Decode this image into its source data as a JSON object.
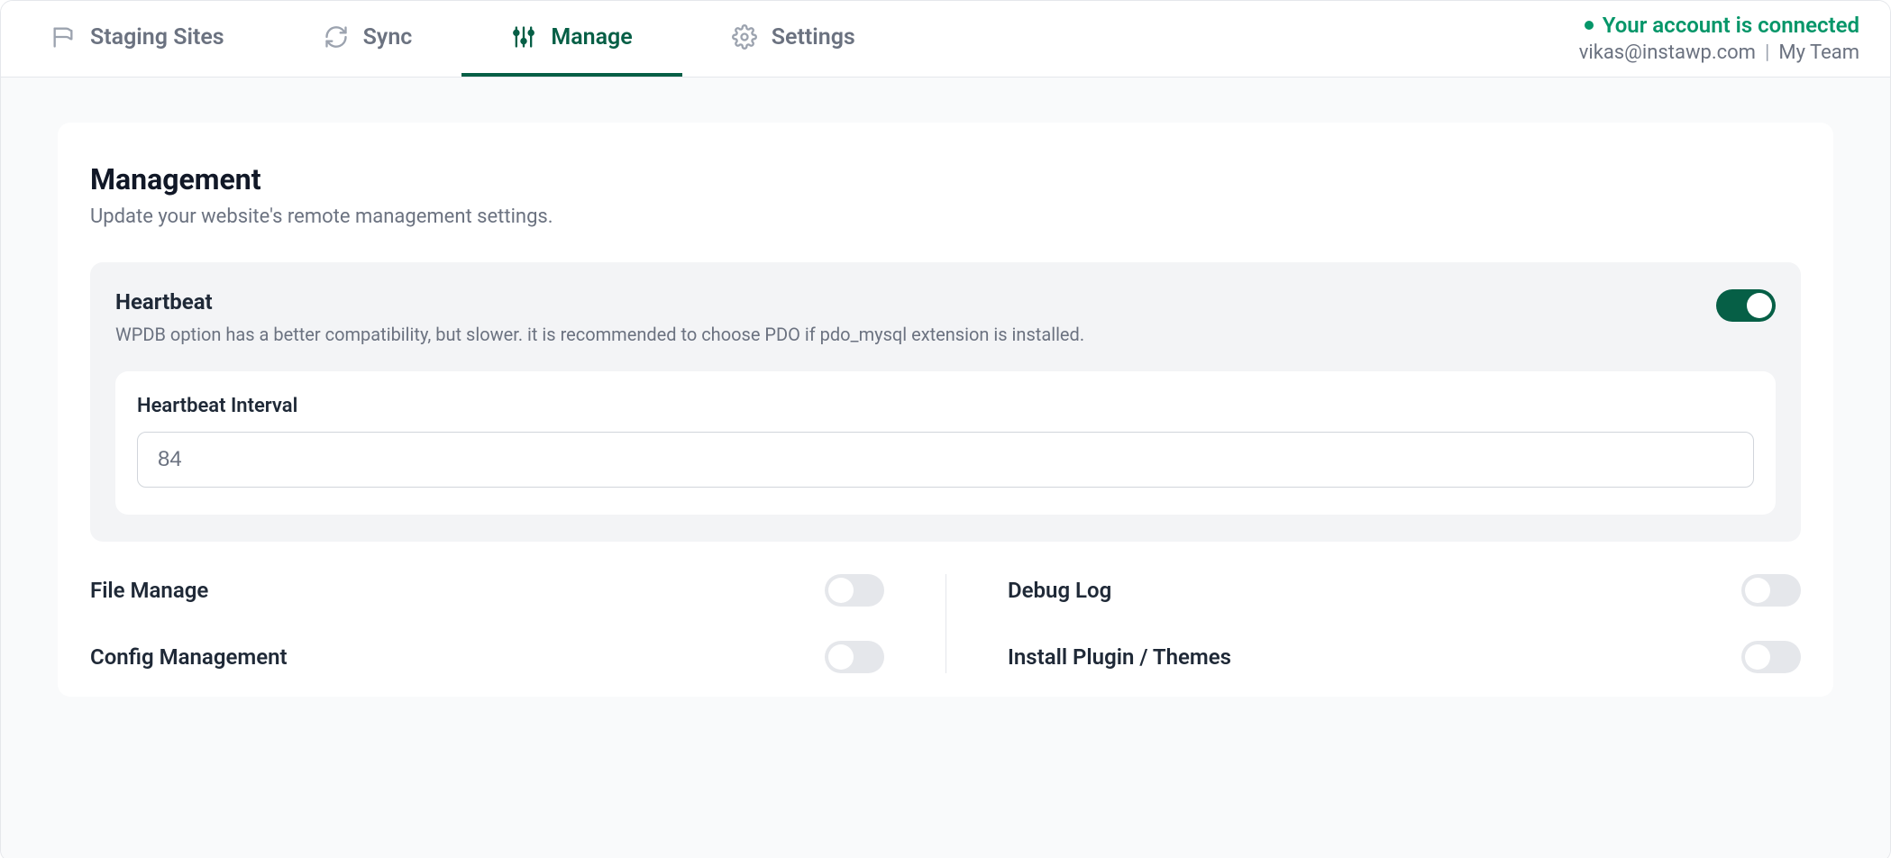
{
  "nav": {
    "tabs": [
      {
        "id": "staging",
        "label": "Staging Sites",
        "icon": "flag",
        "active": false
      },
      {
        "id": "sync",
        "label": "Sync",
        "icon": "refresh",
        "active": false
      },
      {
        "id": "manage",
        "label": "Manage",
        "icon": "sliders",
        "active": true
      },
      {
        "id": "settings",
        "label": "Settings",
        "icon": "gear",
        "active": false
      }
    ]
  },
  "account": {
    "status_text": "Your account is connected",
    "email": "vikas@instawp.com",
    "team": "My Team"
  },
  "page": {
    "title": "Management",
    "subtitle": "Update your website's remote management settings."
  },
  "heartbeat": {
    "title": "Heartbeat",
    "description": "WPDB option has a better compatibility, but slower. it is recommended to choose PDO if pdo_mysql extension is installed.",
    "enabled": true,
    "interval_label": "Heartbeat Interval",
    "interval_value": "84"
  },
  "options": {
    "left": [
      {
        "id": "file_manage",
        "label": "File Manage",
        "enabled": false
      },
      {
        "id": "config_management",
        "label": "Config Management",
        "enabled": false
      }
    ],
    "right": [
      {
        "id": "debug_log",
        "label": "Debug Log",
        "enabled": false
      },
      {
        "id": "install_plugin",
        "label": "Install Plugin / Themes",
        "enabled": false
      }
    ]
  }
}
